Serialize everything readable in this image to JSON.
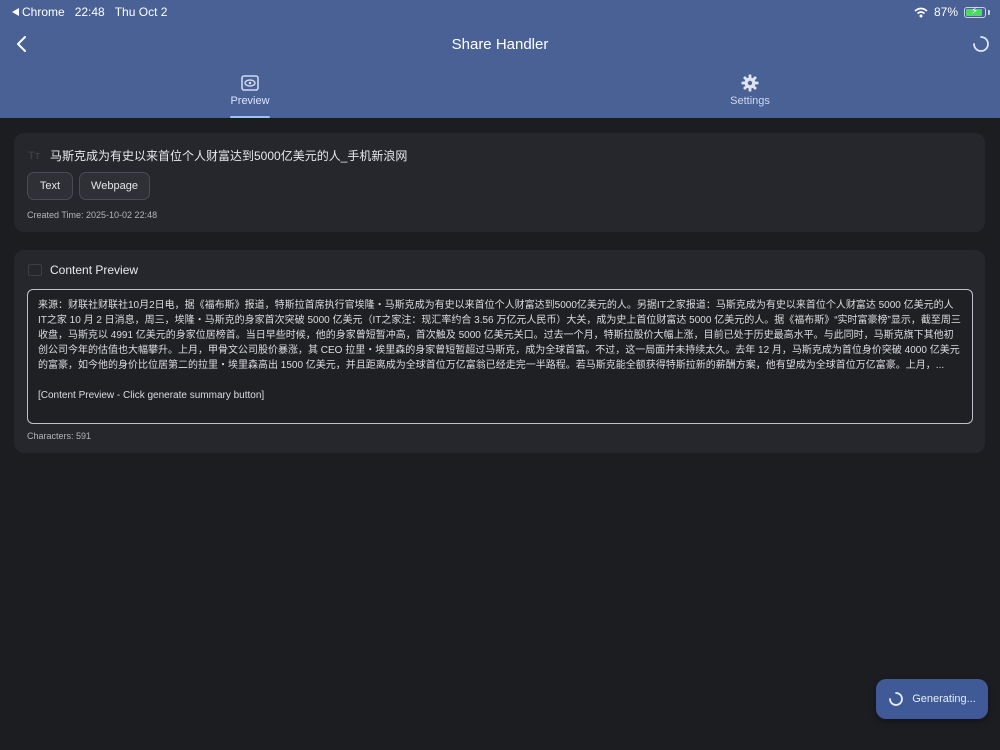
{
  "status_bar": {
    "app": "Chrome",
    "time": "22:48",
    "date": "Thu Oct 2",
    "battery": "87%"
  },
  "nav": {
    "title": "Share Handler"
  },
  "tabs": [
    {
      "label": "Preview",
      "icon": "eye-icon",
      "active": true
    },
    {
      "label": "Settings",
      "icon": "gear-icon",
      "active": false
    }
  ],
  "shared_item": {
    "title": "马斯克成为有史以来首位个人财富达到5000亿美元的人_手机新浪网",
    "chips": [
      "Text",
      "Webpage"
    ],
    "created_time": "Created Time: 2025-10-02 22:48"
  },
  "content_preview": {
    "title": "Content Preview",
    "body": "来源：财联社财联社10月2日电，据《福布斯》报道，特斯拉首席执行官埃隆・马斯克成为有史以来首位个人财富达到5000亿美元的人。另据IT之家报道：马斯克成为有史以来首位个人财富达 5000 亿美元的人IT之家 10 月 2 日消息，周三，埃隆・马斯克的身家首次突破 5000 亿美元（IT之家注：现汇率约合 3.56 万亿元人民币）大关，成为史上首位财富达 5000 亿美元的人。据《福布斯》“实时富豪榜”显示，截至周三收盘，马斯克以 4991 亿美元的身家位居榜首。当日早些时候，他的身家曾短暂冲高，首次触及 5000 亿美元关口。过去一个月，特斯拉股价大幅上涨，目前已处于历史最高水平。与此同时，马斯克旗下其他初创公司今年的估值也大幅攀升。上月，甲骨文公司股价暴涨，其 CEO 拉里・埃里森的身家曾短暂超过马斯克，成为全球首富。不过，这一局面并未持续太久。去年 12 月，马斯克成为首位身价突破 4000 亿美元的富豪，如今他的身价比位居第二的拉里・埃里森高出 1500 亿美元，并且距离成为全球首位万亿富翁已经走完一半路程。若马斯克能全额获得特斯拉新的薪酬方案，他有望成为全球首位万亿富豪。上月，...",
    "summary_hint": "[Content Preview - Click generate summary button]",
    "char_count": "Characters: 591"
  },
  "generate_button": {
    "label": "Generating..."
  },
  "colors": {
    "header": "#4a6196",
    "background": "#1c1d21",
    "card": "#26272c",
    "accent": "#9ec0ff",
    "battery_green": "#4cd964"
  }
}
